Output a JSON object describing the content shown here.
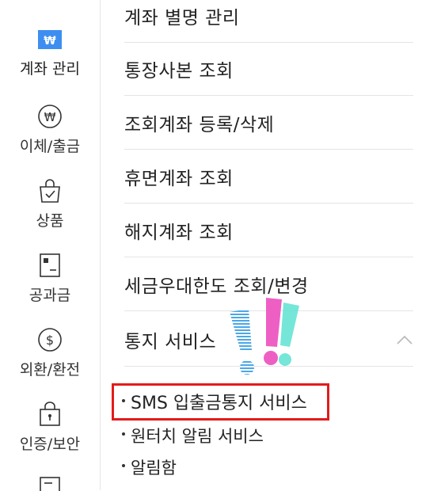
{
  "sidebar": {
    "items": [
      {
        "label": "계좌 관리",
        "icon": "won-card-icon",
        "active": true
      },
      {
        "label": "이체/출금",
        "icon": "won-circle-icon"
      },
      {
        "label": "상품",
        "icon": "shopping-bag-icon"
      },
      {
        "label": "공과금",
        "icon": "bill-icon"
      },
      {
        "label": "외환/환전",
        "icon": "dollar-circle-icon"
      },
      {
        "label": "인증/보안",
        "icon": "lock-icon"
      },
      {
        "label": "",
        "icon": "document-edit-icon"
      }
    ]
  },
  "menu": {
    "items": [
      {
        "label": "계좌 별명 관리"
      },
      {
        "label": "통장사본 조회"
      },
      {
        "label": "조회계좌 등록/삭제"
      },
      {
        "label": "휴면계좌 조회"
      },
      {
        "label": "해지계좌 조회"
      },
      {
        "label": "세금우대한도 조회/변경"
      },
      {
        "label": "통지 서비스",
        "expanded": true
      }
    ],
    "sub_items": [
      {
        "label": "SMS 입출금통지 서비스",
        "highlighted": true
      },
      {
        "label": "원터치 알림 서비스"
      },
      {
        "label": "알림함"
      }
    ]
  },
  "colors": {
    "accent": "#3d8ef0",
    "highlight": "#e31b1b",
    "exclaim_blue": "#4aa8e8",
    "exclaim_pink": "#ee5fc4",
    "exclaim_cyan": "#5ee2d2"
  }
}
